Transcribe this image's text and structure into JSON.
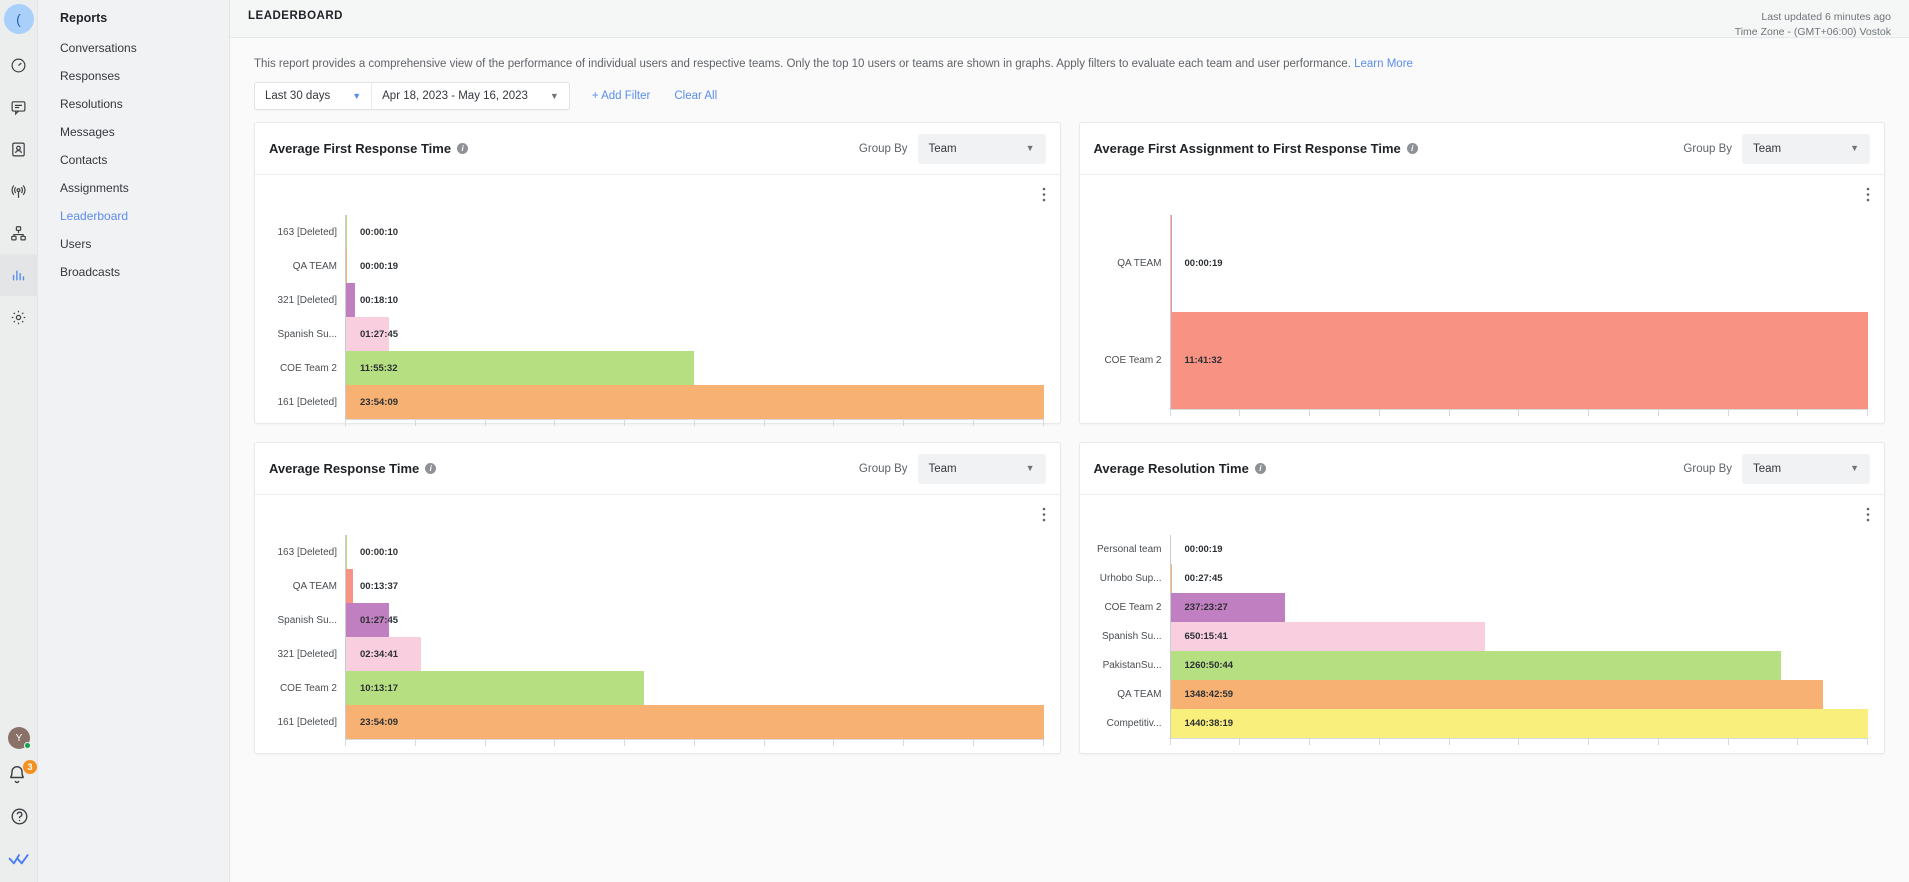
{
  "rail": {
    "logo": "(",
    "icons": [
      {
        "name": "dashboard-gauge-icon",
        "label": "Dashboard"
      },
      {
        "name": "conversations-chat-icon",
        "label": "Conversations"
      },
      {
        "name": "contacts-person-icon",
        "label": "Contacts"
      },
      {
        "name": "broadcasts-antenna-icon",
        "label": "Broadcasts"
      },
      {
        "name": "automation-hierarchy-icon",
        "label": "Automation"
      },
      {
        "name": "reports-bars-icon",
        "label": "Reports"
      },
      {
        "name": "settings-gear-icon",
        "label": "Settings"
      }
    ],
    "avatar_initial": "Y",
    "notification_count": "3"
  },
  "sidebar": {
    "title": "Reports",
    "items": [
      {
        "label": "Conversations",
        "active": false
      },
      {
        "label": "Responses",
        "active": false
      },
      {
        "label": "Resolutions",
        "active": false
      },
      {
        "label": "Messages",
        "active": false
      },
      {
        "label": "Contacts",
        "active": false
      },
      {
        "label": "Assignments",
        "active": false
      },
      {
        "label": "Leaderboard",
        "active": true
      },
      {
        "label": "Users",
        "active": false
      },
      {
        "label": "Broadcasts",
        "active": false
      }
    ]
  },
  "header": {
    "title": "LEADERBOARD",
    "last_updated": "Last updated 6 minutes ago",
    "timezone": "Time Zone - (GMT+06:00) Vostok"
  },
  "description": {
    "text": "This report provides a comprehensive view of the performance of individual users and respective teams. Only the top 10 users or teams are shown in graphs. Apply filters to evaluate each team and user performance.",
    "link_label": "Learn More"
  },
  "filters": {
    "range_preset": "Last 30 days",
    "date_range": "Apr 18, 2023 - May 16, 2023",
    "add_filter_label": "+ Add Filter",
    "clear_all_label": "Clear All"
  },
  "group_by_label": "Group By",
  "group_by_value": "Team",
  "colors": {
    "accent": "#5b8def",
    "orange": "#f7b172",
    "green": "#b5df81",
    "pink": "#f9cfe0",
    "purple": "#c07fc0",
    "salmon": "#f89283",
    "yellow": "#f8ef7c",
    "badge": "#f59123",
    "avatar": "#8a7168",
    "online": "#16a34a"
  },
  "chart_data": [
    {
      "type": "bar",
      "orientation": "horizontal",
      "title": "Average First Response Time",
      "group_by": "Team",
      "xlabel": "",
      "ylabel": "",
      "grid": false,
      "legend": "none",
      "categories": [
        "163 [Deleted]",
        "QA TEAM",
        "321 [Deleted]",
        "Spanish Su...",
        "COE Team 2",
        "161 [Deleted]"
      ],
      "labels": [
        "00:00:10",
        "00:00:19",
        "00:18:10",
        "01:27:45",
        "11:55:32",
        "23:54:09"
      ],
      "values": [
        10,
        19,
        1090,
        5265,
        42932,
        86049
      ],
      "unit": "seconds",
      "max": 86049,
      "colors": [
        "#b5df81",
        "#f7b172",
        "#c07fc0",
        "#f9cfe0",
        "#b5df81",
        "#f7b172"
      ]
    },
    {
      "type": "bar",
      "orientation": "horizontal",
      "title": "Average First Assignment to First Response Time",
      "group_by": "Team",
      "xlabel": "",
      "ylabel": "",
      "grid": false,
      "legend": "none",
      "categories": [
        "QA TEAM",
        "COE Team 2"
      ],
      "labels": [
        "00:00:19",
        "11:41:32"
      ],
      "values": [
        19,
        42092
      ],
      "unit": "seconds",
      "max": 42092,
      "colors": [
        "#f89283",
        "#f89283"
      ]
    },
    {
      "type": "bar",
      "orientation": "horizontal",
      "title": "Average Response Time",
      "group_by": "Team",
      "xlabel": "",
      "ylabel": "",
      "grid": false,
      "legend": "none",
      "categories": [
        "163 [Deleted]",
        "QA TEAM",
        "Spanish Su...",
        "321 [Deleted]",
        "COE Team 2",
        "161 [Deleted]"
      ],
      "labels": [
        "00:00:10",
        "00:13:37",
        "01:27:45",
        "02:34:41",
        "10:13:17",
        "23:54:09"
      ],
      "values": [
        10,
        817,
        5265,
        9281,
        36797,
        86049
      ],
      "unit": "seconds",
      "max": 86049,
      "colors": [
        "#b5df81",
        "#f89283",
        "#c07fc0",
        "#f9cfe0",
        "#b5df81",
        "#f7b172"
      ]
    },
    {
      "type": "bar",
      "orientation": "horizontal",
      "title": "Average Resolution Time",
      "group_by": "Team",
      "xlabel": "",
      "ylabel": "",
      "grid": false,
      "legend": "none",
      "categories": [
        "Personal team",
        "Urhobo Sup...",
        "COE Team 2",
        "Spanish Su...",
        "PakistanSu...",
        "QA TEAM",
        "Competitiv..."
      ],
      "labels": [
        "00:00:19",
        "00:27:45",
        "237:23:27",
        "650:15:41",
        "1260:50:44",
        "1348:42:59",
        "1440:38:19"
      ],
      "values": [
        19,
        1665,
        854607,
        2340941,
        4539044,
        4855379,
        5186299
      ],
      "unit": "seconds",
      "max": 5186299,
      "colors": [
        "#b5df81",
        "#f7b172",
        "#c07fc0",
        "#f9cfe0",
        "#b5df81",
        "#f7b172",
        "#f8ef7c"
      ]
    }
  ]
}
